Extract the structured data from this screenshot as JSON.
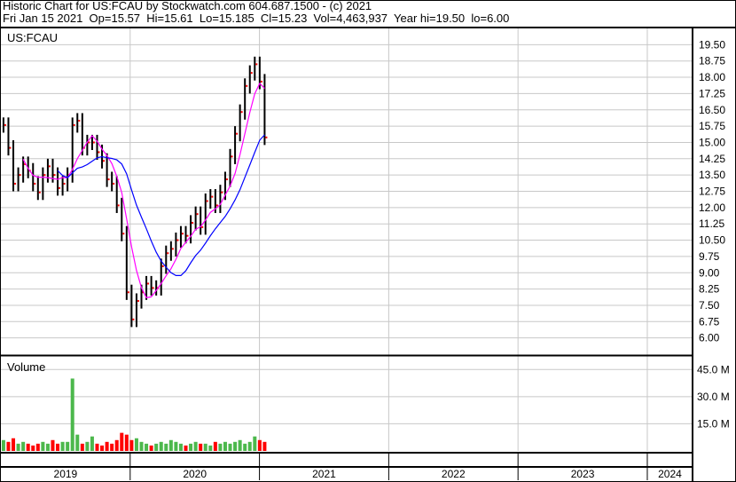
{
  "header": {
    "title": "Historic Chart for US:FCAU by Stockwatch.com 604.687.1500 - (c) 2021",
    "quote": "Fri Jan 15 2021  Op=15.57  Hi=15.61  Lo=15.185  Cl=15.23  Vol=4,463,937  Year hi=19.50  lo=6.00"
  },
  "colors": {
    "up": "#4cb84c",
    "down": "#ff0000",
    "bar": "#000000",
    "ma_short": "#ff00ff",
    "ma_long": "#0000ff",
    "grid": "#c8c8c8"
  },
  "chart_data": {
    "type": "line",
    "symbol_label": "US:FCAU",
    "volume_label": "Volume",
    "price_axis": {
      "ylim": [
        5.25,
        20.25
      ],
      "ticks": [
        19.5,
        18.75,
        18.0,
        17.25,
        16.5,
        15.75,
        15.0,
        14.25,
        13.5,
        12.75,
        12.0,
        11.25,
        10.5,
        9.75,
        9.0,
        8.25,
        7.5,
        6.75,
        6.0
      ],
      "tick_labels": [
        "19.50",
        "18.75",
        "18.00",
        "17.25",
        "16.50",
        "15.75",
        "15.00",
        "14.25",
        "13.50",
        "12.75",
        "12.00",
        "11.25",
        "10.50",
        "9.75",
        "9.00",
        "8.25",
        "7.50",
        "6.75",
        "6.00"
      ]
    },
    "volume_axis": {
      "ylim": [
        0,
        52
      ],
      "ticks": [
        15,
        30,
        45
      ],
      "tick_labels": [
        "15.0 M",
        "30.0 M",
        "45.0 M"
      ]
    },
    "x_axis": {
      "range_years": [
        2019.0,
        2024.35
      ],
      "year_labels": [
        "2019",
        "2020",
        "2021",
        "2022",
        "2023",
        "2024"
      ]
    },
    "series_start": 2019.02,
    "series_end": 2021.04,
    "close": [
      15.8,
      14.75,
      13.1,
      13.5,
      14.0,
      13.7,
      13.1,
      12.7,
      13.5,
      13.9,
      13.5,
      12.9,
      13.1,
      13.5,
      15.8,
      16.0,
      14.75,
      15.0,
      15.0,
      14.55,
      14.15,
      13.3,
      13.1,
      12.1,
      10.8,
      8.1,
      6.85,
      7.7,
      8.1,
      8.5,
      8.3,
      8.3,
      9.3,
      9.9,
      10.1,
      10.5,
      10.8,
      10.7,
      11.3,
      11.7,
      11.1,
      12.3,
      12.5,
      12.1,
      12.7,
      13.3,
      14.35,
      15.4,
      16.4,
      17.6,
      18.2,
      18.6,
      17.8,
      15.23
    ],
    "volume_millions": [
      6,
      5,
      7,
      4,
      5,
      4,
      3,
      4,
      5,
      4,
      6,
      4,
      5,
      5,
      40,
      9,
      4,
      5,
      8,
      4,
      3,
      5,
      4,
      6,
      10,
      9,
      6,
      7,
      5,
      4,
      3,
      4,
      5,
      4,
      6,
      5,
      4,
      3,
      4,
      5,
      4,
      4,
      3,
      5,
      4,
      5,
      4,
      5,
      6,
      4,
      5,
      8,
      6,
      5
    ],
    "moving_averages": [
      {
        "name": "short",
        "periods": 5
      },
      {
        "name": "long",
        "periods": 12
      }
    ]
  }
}
